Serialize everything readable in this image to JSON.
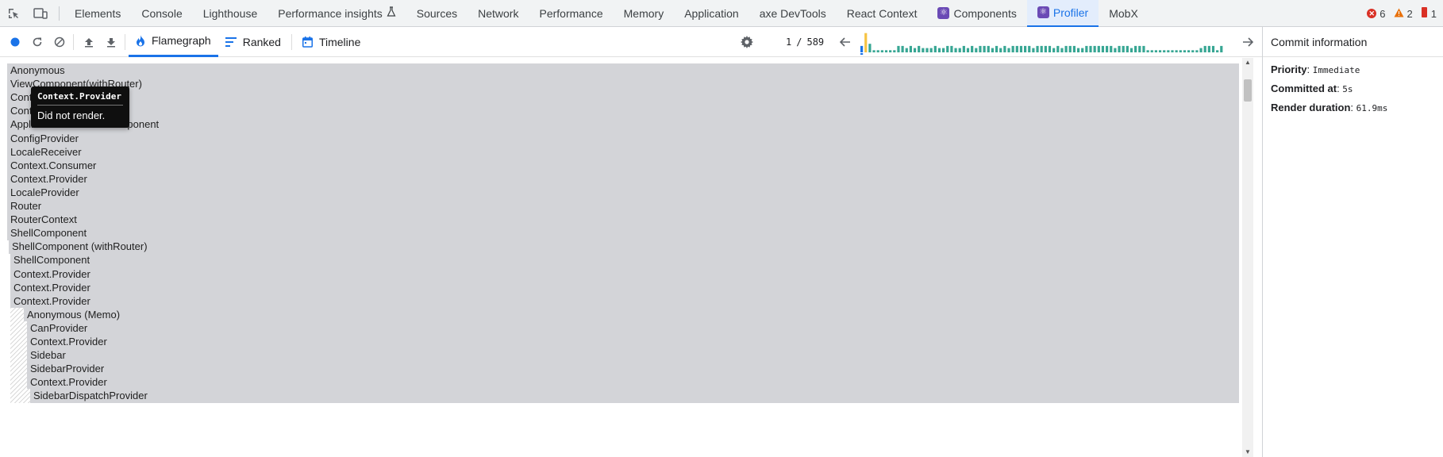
{
  "devtools": {
    "tabs": [
      {
        "label": "Elements"
      },
      {
        "label": "Console"
      },
      {
        "label": "Lighthouse"
      },
      {
        "label": "Performance insights"
      },
      {
        "label": "Sources"
      },
      {
        "label": "Network"
      },
      {
        "label": "Performance"
      },
      {
        "label": "Memory"
      },
      {
        "label": "Application"
      },
      {
        "label": "axe DevTools"
      },
      {
        "label": "React Context"
      },
      {
        "label": "Components"
      },
      {
        "label": "Profiler"
      },
      {
        "label": "MobX"
      }
    ],
    "active_tab": "Profiler",
    "errors": "6",
    "warnings": "2",
    "info": "1",
    "colors": {
      "accent": "#1a73e8",
      "error": "#d93025",
      "warning": "#e8710a",
      "info": "#d93025"
    }
  },
  "toolbar": {
    "view_tabs": [
      {
        "label": "Flamegraph",
        "icon": "flame-icon"
      },
      {
        "label": "Ranked",
        "icon": "ranked-icon"
      },
      {
        "label": "Timeline",
        "icon": "calendar-icon"
      }
    ],
    "commit_current": "1",
    "commit_separator": "/",
    "commit_total": "589",
    "commit_bars": [
      0.3,
      0.9,
      0.4,
      0.1,
      0.1,
      0.1,
      0.1,
      0.1,
      0.1,
      0.3,
      0.3,
      0.2,
      0.3,
      0.2,
      0.3,
      0.2,
      0.2,
      0.2,
      0.3,
      0.2,
      0.2,
      0.3,
      0.3,
      0.2,
      0.2,
      0.3,
      0.2,
      0.3,
      0.2,
      0.3,
      0.3,
      0.3,
      0.2,
      0.3,
      0.2,
      0.3,
      0.2,
      0.3,
      0.3,
      0.3,
      0.3,
      0.3,
      0.2,
      0.3,
      0.3,
      0.3,
      0.3,
      0.2,
      0.3,
      0.2,
      0.3,
      0.3,
      0.3,
      0.2,
      0.2,
      0.3,
      0.3,
      0.3,
      0.3,
      0.3,
      0.3,
      0.3,
      0.2,
      0.3,
      0.3,
      0.3,
      0.2,
      0.3,
      0.3,
      0.3,
      0.1,
      0.1,
      0.1,
      0.1,
      0.1,
      0.1,
      0.1,
      0.1,
      0.1,
      0.1,
      0.1,
      0.1,
      0.1,
      0.2,
      0.3,
      0.3,
      0.3,
      0.1,
      0.3
    ],
    "commit_selected_index": 0,
    "commit_highlight_index": 1,
    "commit_colors": {
      "selected": "#1a73e8",
      "highlight": "#f6c343",
      "normal": "#37a693"
    }
  },
  "flamegraph": {
    "rows": [
      {
        "label": "Anonymous",
        "depth": 0,
        "hatched": false
      },
      {
        "label": "ViewComponent(withRouter)",
        "depth": 0,
        "hatched": false
      },
      {
        "label": "Context.Consumer",
        "depth": 0,
        "hatched": false
      },
      {
        "label": "Context.Provider",
        "depth": 0,
        "hatched": false
      },
      {
        "label": "ApplicationContainerComponent",
        "depth": 0,
        "hatched": false
      },
      {
        "label": "ConfigProvider",
        "depth": 0,
        "hatched": false
      },
      {
        "label": "LocaleReceiver",
        "depth": 0,
        "hatched": false
      },
      {
        "label": "Context.Consumer",
        "depth": 0,
        "hatched": false
      },
      {
        "label": "Context.Provider",
        "depth": 0,
        "hatched": false
      },
      {
        "label": "LocaleProvider",
        "depth": 0,
        "hatched": false
      },
      {
        "label": "Router",
        "depth": 0,
        "hatched": false
      },
      {
        "label": "RouterContext",
        "depth": 0,
        "hatched": false
      },
      {
        "label": "ShellComponent",
        "depth": 0,
        "hatched": false
      },
      {
        "label": "ShellComponent (withRouter)",
        "depth": 1,
        "hatched": false
      },
      {
        "label": "ShellComponent",
        "depth": 2,
        "hatched": false
      },
      {
        "label": "Context.Provider",
        "depth": 2,
        "hatched": false
      },
      {
        "label": "Context.Provider",
        "depth": 2,
        "hatched": false
      },
      {
        "label": "Context.Provider",
        "depth": 2,
        "hatched": false
      },
      {
        "label": "Anonymous (Memo)",
        "depth": 3,
        "hatched": true
      },
      {
        "label": "CanProvider",
        "depth": 4,
        "hatched": true
      },
      {
        "label": "Context.Provider",
        "depth": 4,
        "hatched": true
      },
      {
        "label": "Sidebar",
        "depth": 4,
        "hatched": true
      },
      {
        "label": "SidebarProvider",
        "depth": 4,
        "hatched": true
      },
      {
        "label": "Context.Provider",
        "depth": 4,
        "hatched": true
      },
      {
        "label": "SidebarDispatchProvider",
        "depth": 5,
        "hatched": true
      }
    ],
    "tooltip": {
      "title": "Context.Provider",
      "body": "Did not render."
    }
  },
  "commit_info": {
    "title": "Commit information",
    "items": [
      {
        "label": "Priority",
        "value": "Immediate"
      },
      {
        "label": "Committed at",
        "value": "5s"
      },
      {
        "label": "Render duration",
        "value": "61.9ms"
      }
    ]
  }
}
